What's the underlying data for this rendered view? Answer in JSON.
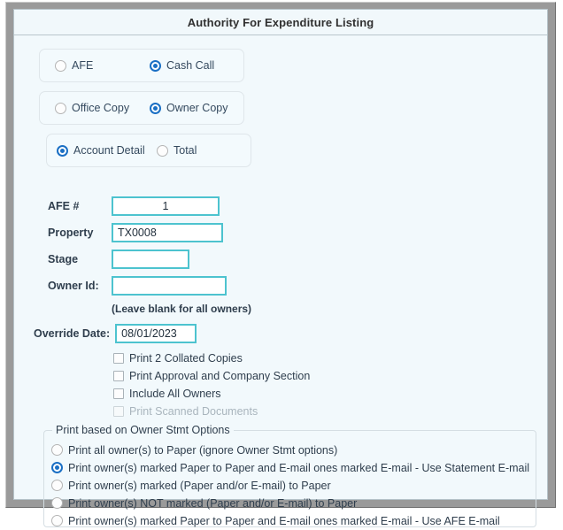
{
  "window": {
    "title": "Authority For Expenditure Listing"
  },
  "type_panel": {
    "options": [
      {
        "label": "AFE",
        "selected": false
      },
      {
        "label": "Cash Call",
        "selected": true
      }
    ]
  },
  "copy_panel": {
    "options": [
      {
        "label": "Office Copy",
        "selected": false
      },
      {
        "label": "Owner Copy",
        "selected": true
      }
    ]
  },
  "detail_panel": {
    "options": [
      {
        "label": "Account Detail",
        "selected": true
      },
      {
        "label": "Total",
        "selected": false
      }
    ]
  },
  "fields": {
    "afe": {
      "label": "AFE #",
      "value": "1",
      "placeholder": ""
    },
    "property": {
      "label": "Property",
      "value": "TX0008",
      "placeholder": ""
    },
    "stage": {
      "label": "Stage",
      "value": "",
      "placeholder": ""
    },
    "owner_id": {
      "label": "Owner Id:",
      "value": "",
      "placeholder": ""
    },
    "owner_hint": "(Leave blank for all owners)",
    "override_date": {
      "label": "Override Date:",
      "value": "08/01/2023",
      "placeholder": ""
    }
  },
  "checkboxes": [
    {
      "label": "Print 2 Collated Copies",
      "checked": false,
      "disabled": false
    },
    {
      "label": "Print Approval and Company Section",
      "checked": false,
      "disabled": false
    },
    {
      "label": "Include All Owners",
      "checked": false,
      "disabled": false
    },
    {
      "label": "Print Scanned Documents",
      "checked": false,
      "disabled": true
    }
  ],
  "owner_stmt_group": {
    "legend": "Print based on Owner Stmt Options",
    "options": [
      {
        "label": "Print all owner(s) to Paper (ignore Owner Stmt options)",
        "selected": false
      },
      {
        "label": "Print owner(s) marked Paper to Paper and E-mail ones marked E-mail - Use Statement E-mail",
        "selected": true
      },
      {
        "label": "Print owner(s) marked (Paper and/or E-mail) to Paper",
        "selected": false
      },
      {
        "label": "Print owner(s) NOT marked (Paper and/or E-mail) to Paper",
        "selected": false
      },
      {
        "label": "Print owner(s) marked Paper to Paper and E-mail ones marked E-mail - Use AFE E-mail",
        "selected": false
      }
    ]
  },
  "colors": {
    "accent_input_border": "#4dc3cf",
    "radio_selected": "#1a6fc4",
    "panel_background": "#f2f9fc",
    "window_frame": "#9a9a9a"
  }
}
